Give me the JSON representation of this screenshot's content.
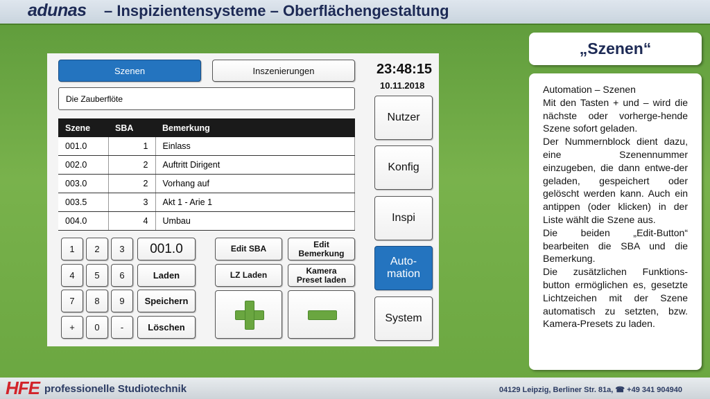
{
  "header": {
    "brand": "adunas",
    "title": "– Inspizientensysteme – Oberflächengestaltung"
  },
  "tabs": {
    "scenes": "Szenen",
    "productions": "Inszenierungen"
  },
  "clock": {
    "time": "23:48:15",
    "date": "10.11.2018"
  },
  "production_title": "Die Zauberflöte",
  "table": {
    "headers": [
      "Szene",
      "SBA",
      "Bemerkung"
    ],
    "rows": [
      [
        "001.0",
        "1",
        "Einlass"
      ],
      [
        "002.0",
        "2",
        "Auftritt Dirigent"
      ],
      [
        "003.0",
        "2",
        "Vorhang auf"
      ],
      [
        "003.5",
        "3",
        "Akt 1 - Arie 1"
      ],
      [
        "004.0",
        "4",
        "Umbau"
      ]
    ]
  },
  "keypad": {
    "keys": [
      "1",
      "2",
      "3",
      "4",
      "5",
      "6",
      "7",
      "8",
      "9",
      "+",
      "0",
      "-"
    ],
    "display": "001.0",
    "load": "Laden",
    "save": "Speichern",
    "delete": "Löschen"
  },
  "actions": {
    "edit_sba": "Edit SBA",
    "edit_remark": "Edit Bemerkung",
    "lz_load": "LZ Laden",
    "camera_preset": "Kamera Preset laden"
  },
  "nav": {
    "user": "Nutzer",
    "config": "Konfig",
    "inspi": "Inspi",
    "automation": "Auto-mation",
    "system": "System"
  },
  "side": {
    "title": "„Szenen“",
    "heading": "Automation – Szenen",
    "paragraphs": [
      "Mit den Tasten + und – wird die nächste oder vorherge-hende Szene sofort geladen.",
      "Der Nummernblock dient dazu, eine Szenennummer einzugeben, die dann entwe-der geladen, gespeichert oder gelöscht werden kann. Auch ein antippen (oder klicken) in der Liste wählt die Szene aus.",
      "Die beiden „Edit-Button“ bearbeiten die SBA und die Bemerkung.",
      "Die zusätzlichen Funktions-button ermöglichen es, gesetzte Lichtzeichen mit der Szene automatisch zu setzten, bzw. Kamera-Presets zu laden."
    ]
  },
  "footer": {
    "logo": "HFE",
    "slogan": "professionelle Studiotechnik",
    "address": "04129 Leipzig, Berliner Str. 81a, ☎ +49 341 904940"
  },
  "colors": {
    "active_blue": "#2474bf",
    "header_navy": "#1d2a55",
    "background_green": "#79b24c",
    "logo_red": "#d2232a"
  }
}
